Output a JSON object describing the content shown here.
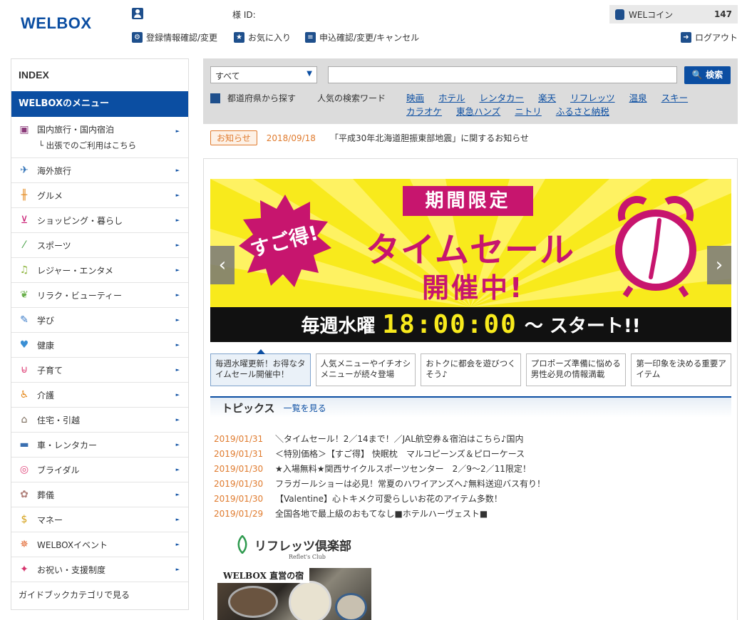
{
  "header": {
    "logo": "WELBOX",
    "user_suffix": "様  ID:",
    "links": {
      "profile": "登録情報確認/変更",
      "favorites": "お気に入り",
      "applications": "申込確認/変更/キャンセル",
      "logout": "ログアウト"
    },
    "coin_label": "WELコイン",
    "coin_value": "147"
  },
  "sidebar": {
    "index_title": "INDEX",
    "menu_title": "WELBOXのメニュー",
    "items": [
      {
        "label": "国内旅行・国内宿泊",
        "sub": "└ 出張でのご利用はこちら",
        "icon": "suitcase-icon"
      },
      {
        "label": "海外旅行",
        "icon": "airplane-icon"
      },
      {
        "label": "グルメ",
        "icon": "cutlery-icon"
      },
      {
        "label": "ショッピング・暮らし",
        "icon": "cart-icon"
      },
      {
        "label": "スポーツ",
        "icon": "sports-icon"
      },
      {
        "label": "レジャー・エンタメ",
        "icon": "music-note-icon"
      },
      {
        "label": "リラク・ビューティー",
        "icon": "leaf-icon"
      },
      {
        "label": "学び",
        "icon": "pencil-icon"
      },
      {
        "label": "健康",
        "icon": "heart-icon"
      },
      {
        "label": "子育て",
        "icon": "stroller-icon"
      },
      {
        "label": "介護",
        "icon": "care-icon"
      },
      {
        "label": "住宅・引越",
        "icon": "house-icon"
      },
      {
        "label": "車・レンタカー",
        "icon": "car-icon"
      },
      {
        "label": "ブライダル",
        "icon": "ring-icon"
      },
      {
        "label": "葬儀",
        "icon": "flower-icon"
      },
      {
        "label": "マネー",
        "icon": "money-icon"
      },
      {
        "label": "WELBOXイベント",
        "icon": "event-icon"
      },
      {
        "label": "お祝い・支援制度",
        "icon": "celebration-icon"
      }
    ],
    "guidebook": "ガイドブックカテゴリで見る"
  },
  "search": {
    "select_value": "すべて",
    "input_value": "",
    "button_label": "検索",
    "pref_label": "都道府県から探す",
    "popular_label": "人気の検索ワード",
    "keywords": [
      "映画",
      "ホテル",
      "レンタカー",
      "楽天",
      "リフレッツ",
      "温泉",
      "スキー",
      "カラオケ",
      "東急ハンズ",
      "ニトリ",
      "ふるさと納税"
    ]
  },
  "notice": {
    "badge": "お知らせ",
    "date": "2018/09/18",
    "text": "「平成30年北海道胆振東部地震」に関するお知らせ"
  },
  "banner": {
    "badge": "すご得!",
    "kikan": "期間限定",
    "title": "タイムセール",
    "kaisai": "開催中!",
    "weekly": "毎週水曜",
    "time": "18:00:00",
    "start": "〜 スタート!!",
    "colors": {
      "yellow": "#f8ea1c",
      "magenta": "#c7156e",
      "black": "#111111"
    }
  },
  "carousel_tabs": [
    "毎週水曜更新！お得なタイムセール開催中！",
    "人気メニューやイチオシメニューが続々登場",
    "おトクに都会を遊びつくそう♪",
    "プロポーズ準備に悩める男性必見の情報満載",
    "第一印象を決める重要アイテム"
  ],
  "topics": {
    "title": "トピックス",
    "view_all": "一覧を見る",
    "items": [
      {
        "date": "2019/01/31",
        "text": "＼タイムセール！2／14まで！／JAL航空券＆宿泊はこちら♪国内"
      },
      {
        "date": "2019/01/31",
        "text": "＜特別価格＞【すご得】 快眠枕　マルコピーンズ＆ピローケース"
      },
      {
        "date": "2019/01/30",
        "text": "★入場無料★関西サイクルスポーツセンター　2／9〜2／11限定！"
      },
      {
        "date": "2019/01/30",
        "text": "フラガールショーは必見！常夏のハワイアンズへ♪無料送迎バス有り！"
      },
      {
        "date": "2019/01/30",
        "text": "【Valentine】心トキメク可愛らしいお花のアイテム多数！"
      },
      {
        "date": "2019/01/29",
        "text": "全国各地で最上級のおもてなし■ホテルハーヴェスト■"
      }
    ]
  },
  "promo": {
    "reflets_name": "リフレッツ倶楽部",
    "reflets_sub": "Reflet's Club",
    "hotel_label": "WELBOX 直営の宿"
  }
}
